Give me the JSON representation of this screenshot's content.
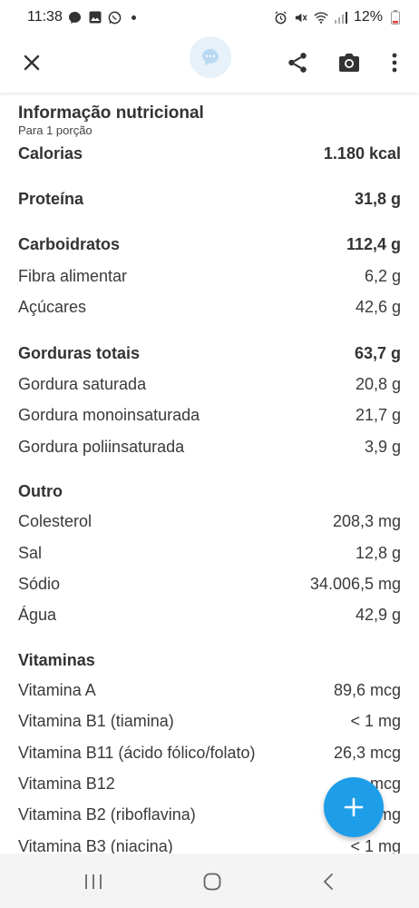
{
  "status_bar": {
    "time": "11:38",
    "battery": "12%"
  },
  "header": {
    "close_icon": "close-icon",
    "chat_icon": "chat-bubble-icon",
    "share_icon": "share-icon",
    "camera_icon": "camera-icon",
    "more_icon": "more-vertical-icon"
  },
  "nutrition": {
    "title": "Informação nutricional",
    "subtitle": "Para 1 porção",
    "calories": {
      "label": "Calorias",
      "value": "1.180 kcal"
    },
    "protein": {
      "label": "Proteína",
      "value": "31,8 g"
    },
    "carbs": {
      "label": "Carboidratos",
      "value": "112,4 g"
    },
    "fiber": {
      "label": "Fibra alimentar",
      "value": "6,2 g"
    },
    "sugars": {
      "label": "Açúcares",
      "value": "42,6 g"
    },
    "fat_total": {
      "label": "Gorduras totais",
      "value": "63,7 g"
    },
    "fat_saturated": {
      "label": "Gordura saturada",
      "value": "20,8 g"
    },
    "fat_mono": {
      "label": "Gordura monoinsaturada",
      "value": "21,7 g"
    },
    "fat_poly": {
      "label": "Gordura poliinsaturada",
      "value": "3,9 g"
    },
    "other_heading": "Outro",
    "cholesterol": {
      "label": "Colesterol",
      "value": "208,3 mg"
    },
    "salt": {
      "label": "Sal",
      "value": "12,8 g"
    },
    "sodium": {
      "label": "Sódio",
      "value": "34.006,5 mg"
    },
    "water": {
      "label": "Água",
      "value": "42,9 g"
    },
    "vitamins_heading": "Vitaminas",
    "vit_a": {
      "label": "Vitamina A",
      "value": "89,6 mcg"
    },
    "vit_b1": {
      "label": "Vitamina B1 (tiamina)",
      "value": "< 1 mg"
    },
    "vit_b11": {
      "label": "Vitamina B11 (ácido fólico/folato)",
      "value": "26,3 mcg"
    },
    "vit_b12": {
      "label": "Vitamina B12",
      "value": "mcg"
    },
    "vit_b2": {
      "label": "Vitamina B2 (riboflavina)",
      "value": "mg"
    },
    "vit_b3": {
      "label": "Vitamina B3 (niacina)",
      "value": "< 1 mg"
    }
  },
  "fab": {
    "icon": "plus-icon"
  },
  "colors": {
    "accent": "#1e9ee8",
    "chat_bg": "#e6f1fa"
  }
}
